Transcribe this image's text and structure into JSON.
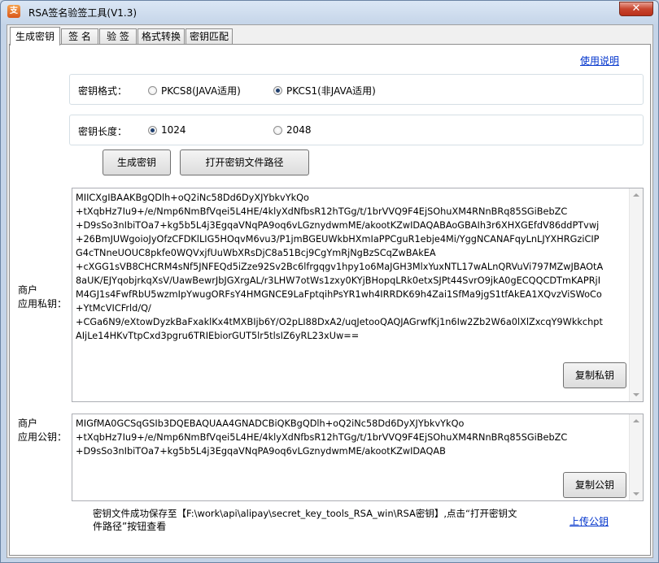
{
  "window": {
    "title": "RSA签名验签工具(V1.3)",
    "close_glyph": "✕",
    "app_icon_glyph": "支"
  },
  "tabs": [
    {
      "label": "生成密钥",
      "active": true
    },
    {
      "label": "签  名",
      "active": false
    },
    {
      "label": "验  签",
      "active": false
    },
    {
      "label": "格式转换",
      "active": false
    },
    {
      "label": "密钥匹配",
      "active": false
    }
  ],
  "help_link": "使用说明",
  "key_format": {
    "label": "密钥格式：",
    "options": [
      {
        "label": "PKCS8(JAVA适用)",
        "checked": false
      },
      {
        "label": "PKCS1(非JAVA适用)",
        "checked": true
      }
    ]
  },
  "key_length": {
    "label": "密钥长度：",
    "options": [
      {
        "label": "1024",
        "checked": true
      },
      {
        "label": "2048",
        "checked": false
      }
    ]
  },
  "buttons": {
    "generate": "生成密钥",
    "open_path": "打开密钥文件路径",
    "copy_private": "复制私钥",
    "copy_public": "复制公钥"
  },
  "private_key": {
    "label_line1": "商户",
    "label_line2": "应用私钥：",
    "text": "MIICXgIBAAKBgQDlh+oQ2iNc58Dd6DyXJYbkvYkQo\n+tXqbHz7Iu9+/e/Nmp6NmBfVqei5L4HE/4klyXdNfbsR12hTGg/t/1brVVQ9F4EjSOhuXM4RNnBRq85SGiBebZC\n+D9sSo3nIbiTOa7+kg5b5L4j3EgqaVNqPA9oq6vLGznydwmME/akootKZwIDAQABAoGBAIh3r6XHXGEfdV86ddPTvwj\n+26BmJUWgoioJyOfzCFDKlLIG5HOqvM6vu3/P1jmBGEUWkbHXmIaPPCguR1ebje4Mi/YggNCANAFqyLnLJYXHRGziCIP\nG4cTNneUOUC8pkfe0WQVxjfUuWbXRsDjC8a51Bcj9CgYmRjNgBzSCqZwBAkEA\n+cXGG1sVB8CHCRM4sNf5JNFEQd5iZze92Sv2Bc6lfrgqgv1hpy1o6MaJGH3MlxYuxNTL17wALnQRVuVi797MZwJBAOtA\n8aUK/EJYqobjrkqXsV/UawBewrJbJGXrgAL/r3LHW7otWs1zxy0KYjBHopqLRk0etxSJPt44SvrO9jkA0gECQQCDTmKAPRjI\nM4GJ1s4FwfRbU5wzmIpYwugORFsY4HMGNCE9LaFptqihPsYR1wh4IRRDK69h4Zai1SfMa9jgS1tfAkEA1XQvzViSWoCo\n+YtMcVICFrld/Q/\n+CGa6N9/eXtowDyzkBaFxaklKx4tMXBIjb6Y/O2pLI88DxA2/uqJetooQAQJAGrwfKj1n6Iw2Zb2W6a0lXlZxcqY9Wkkchpt\nAIjLe14HKvTtpCxd3pgru6TRIEbiorGUT5lr5tlsIZ6yRL23xUw=="
  },
  "public_key": {
    "label_line1": "商户",
    "label_line2": "应用公钥：",
    "text": "MIGfMA0GCSqGSIb3DQEBAQUAA4GNADCBiQKBgQDlh+oQ2iNc58Dd6DyXJYbkvYkQo\n+tXqbHz7Iu9+/e/Nmp6NmBfVqei5L4HE/4klyXdNfbsR12hTGg/t/1brVVQ9F4EjSOhuXM4RNnBRq85SGiBebZC\n+D9sSo3nIbiTOa7+kg5b5L4j3EgqaVNqPA9oq6vLGznydwmME/akootKZwIDAQAB"
  },
  "status": {
    "line1": "密钥文件成功保存至【F:\\work\\api\\alipay\\secret_key_tools_RSA_win\\RSA密钥】,点击“打开密钥文",
    "line2": "件路径”按钮查看"
  },
  "upload_link": "上传公钥"
}
